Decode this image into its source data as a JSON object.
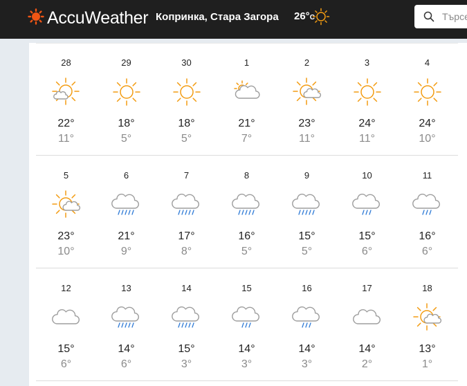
{
  "header": {
    "brand": "AccuWeather",
    "location": "Копринка, Стара Загора",
    "current_temp": "26°",
    "current_unit": "C",
    "current_icon": "sun-icon",
    "search_placeholder": "Търсе"
  },
  "colors": {
    "topbar": "#1f1f1f",
    "brand_orange": "#f05514",
    "sun": "#f39c12",
    "cloud": "#9e9e9e",
    "rain": "#2f7bd6"
  },
  "weeks": [
    {
      "days": [
        {
          "date": "28",
          "hi": "22°",
          "lo": "11°",
          "icon": "sun-cloud-small-icon"
        },
        {
          "date": "29",
          "hi": "18°",
          "lo": "5°",
          "icon": "sun-icon"
        },
        {
          "date": "30",
          "hi": "18°",
          "lo": "5°",
          "icon": "sun-icon"
        },
        {
          "date": "1",
          "hi": "21°",
          "lo": "7°",
          "icon": "cloud-sun-icon"
        },
        {
          "date": "2",
          "hi": "23°",
          "lo": "11°",
          "icon": "sun-cloud-icon"
        },
        {
          "date": "3",
          "hi": "24°",
          "lo": "11°",
          "icon": "sun-icon"
        },
        {
          "date": "4",
          "hi": "24°",
          "lo": "10°",
          "icon": "sun-icon"
        }
      ]
    },
    {
      "days": [
        {
          "date": "5",
          "hi": "23°",
          "lo": "10°",
          "icon": "sun-cloud-icon"
        },
        {
          "date": "6",
          "hi": "21°",
          "lo": "9°",
          "icon": "rain-cloud-icon"
        },
        {
          "date": "7",
          "hi": "17°",
          "lo": "8°",
          "icon": "rain-cloud-icon"
        },
        {
          "date": "8",
          "hi": "16°",
          "lo": "5°",
          "icon": "rain-cloud-icon"
        },
        {
          "date": "9",
          "hi": "15°",
          "lo": "5°",
          "icon": "rain-cloud-icon"
        },
        {
          "date": "10",
          "hi": "15°",
          "lo": "6°",
          "icon": "shower-cloud-icon"
        },
        {
          "date": "11",
          "hi": "16°",
          "lo": "6°",
          "icon": "shower-cloud-icon"
        }
      ]
    },
    {
      "days": [
        {
          "date": "12",
          "hi": "15°",
          "lo": "6°",
          "icon": "cloud-icon"
        },
        {
          "date": "13",
          "hi": "14°",
          "lo": "6°",
          "icon": "rain-cloud-icon"
        },
        {
          "date": "14",
          "hi": "15°",
          "lo": "3°",
          "icon": "rain-cloud-icon"
        },
        {
          "date": "15",
          "hi": "14°",
          "lo": "3°",
          "icon": "shower-cloud-icon"
        },
        {
          "date": "16",
          "hi": "14°",
          "lo": "3°",
          "icon": "shower-cloud-icon"
        },
        {
          "date": "17",
          "hi": "14°",
          "lo": "2°",
          "icon": "cloud-icon"
        },
        {
          "date": "18",
          "hi": "13°",
          "lo": "1°",
          "icon": "sun-cloud-icon"
        }
      ]
    }
  ]
}
